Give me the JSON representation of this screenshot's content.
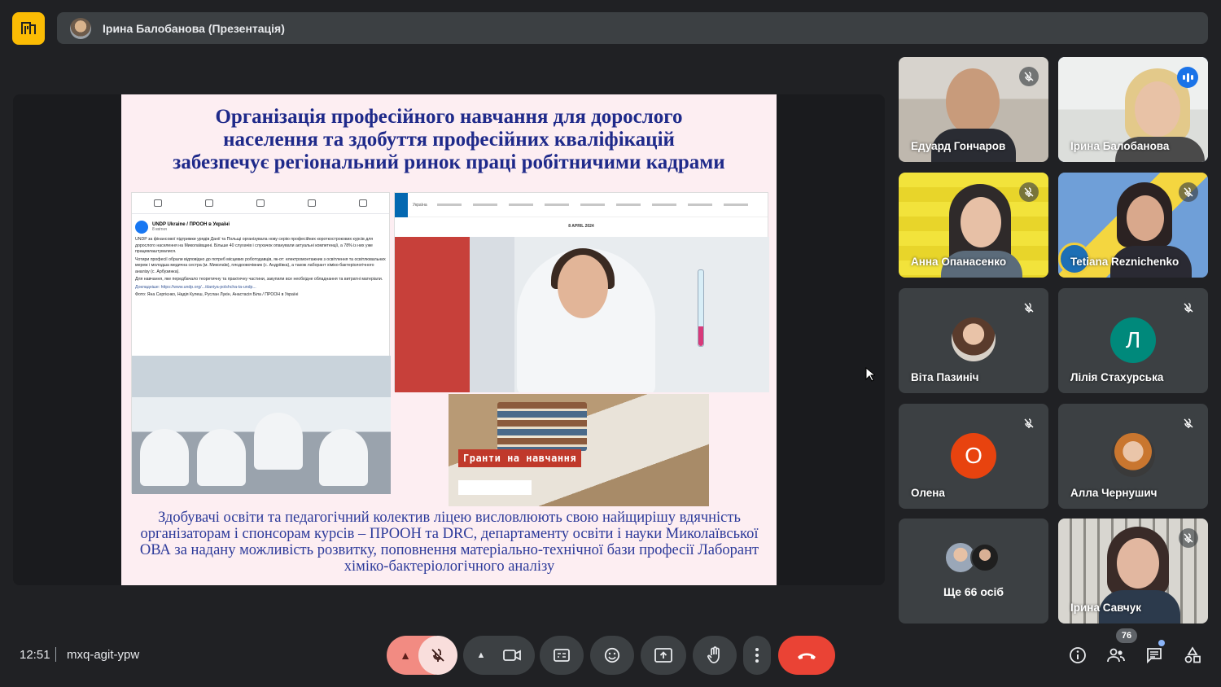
{
  "top_bar": {
    "presenter_label": "Ірина Балобанова (Презентація)"
  },
  "slide": {
    "title_lines": [
      "Організація професійного навчання для дорослого",
      "населення та здобуття професійних кваліфікацій",
      "забезпечує регіональний ринок праці робітничими кадрами"
    ],
    "body_text": "Здобувачі освіти та педагогічний колектив ліцею висловлюють свою найщирішу вдячність організаторам і спонсорам курсів – ПРООН та DRC, департаменту освіти і науки Миколаївської ОВА за надану можливість розвитку, поповнення матеріально-технічної бази професії Лаборант хіміко-бактеріологічного аналізу",
    "fb_post": {
      "page_name": "UNDP Ukraine / ПРООН в Україні",
      "time": "8 квітня",
      "paragraphs": [
        "UNDP за фінансової підтримки урядів Данії та Польщі організувала нову серію професійних короткострокових курсів для дорослого населення на Миколаївщині. Більше 40 слухачів і слухачок опанували актуальні компетенції, а 78% із них уже працевлаштувалися.",
        "Чотири професії обрали відповідно до потреб місцевих роботодавців, як-от: електромонтажник з освітлення та освітлювальних мереж і молодша медична сестра (м. Миколаїв), плодоовочівник (с. Андріївка), а також лаборант хіміко-бактеріологічного аналізу (с. Арбузинка).",
        "Для навчання, яке передбачало теоретичну та практичну частини, закупили все необхідне обладнання та витратні матеріали.",
        "Докладніше: https://www.undp.org/.../daniya-polshcha-ta-undp...",
        "Фото: Яна Сергієнко, Надія Кулеш, Руслан Лукін, Анастасія Біла / ПРООН в Україні"
      ]
    },
    "undp_site": {
      "nav_label": "Україна",
      "date": "8 APRIL 2024"
    },
    "grant_label": "Гранти на навчання"
  },
  "participants": [
    {
      "name": "Едуард Гончаров",
      "type": "video",
      "mic": "off"
    },
    {
      "name": "Ірина Балобанова",
      "type": "video",
      "mic": "speaking"
    },
    {
      "name": "Анна Опанасенко",
      "type": "video",
      "mic": "off"
    },
    {
      "name": "Tetiana Reznichenko",
      "type": "video",
      "mic": "off"
    },
    {
      "name": "Віта Пазиніч",
      "type": "photo",
      "mic": "off"
    },
    {
      "name": "Лілія Стахурська",
      "type": "initial",
      "initial": "Л",
      "color": "#00897b",
      "mic": "off"
    },
    {
      "name": "Олена",
      "type": "initial",
      "initial": "О",
      "color": "#e8430f",
      "mic": "off"
    },
    {
      "name": "Алла Чернушич",
      "type": "photo",
      "mic": "off"
    },
    {
      "name": "Ірина Савчук",
      "type": "video",
      "mic": "off"
    }
  ],
  "more_tile": {
    "label": "Ще 66 осіб"
  },
  "bottom_bar": {
    "time": "12:51",
    "meeting_code": "mxq-agit-ypw",
    "participant_count": "76"
  },
  "colors": {
    "background": "#202124",
    "tile": "#3c4043",
    "end_call": "#ea4335",
    "accent": "#8ab4f8",
    "logo": "#fbbc04"
  }
}
